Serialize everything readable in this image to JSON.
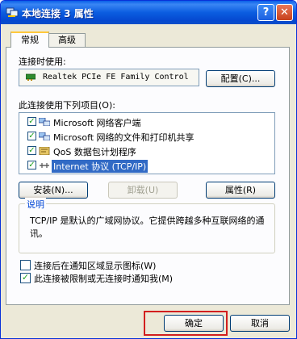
{
  "window": {
    "title": "本地连接 3 属性",
    "help_glyph": "?",
    "close_glyph": "✕"
  },
  "tabs": [
    {
      "label": "常规",
      "active": true
    },
    {
      "label": "高级",
      "active": false
    }
  ],
  "connect_using": {
    "label": "连接时使用:",
    "adapter": "Realtek PCIe FE Family Control",
    "configure_label": "配置(C)..."
  },
  "items_section": {
    "label": "此连接使用下列项目(O):",
    "items": [
      {
        "label": "Microsoft 网络客户端",
        "checked": true,
        "selected": false,
        "icon": "network-client-icon"
      },
      {
        "label": "Microsoft 网络的文件和打印机共享",
        "checked": true,
        "selected": false,
        "icon": "file-printer-sharing-icon"
      },
      {
        "label": "QoS 数据包计划程序",
        "checked": true,
        "selected": false,
        "icon": "qos-scheduler-icon"
      },
      {
        "label": "Internet 协议 (TCP/IP)",
        "checked": true,
        "selected": true,
        "icon": "protocol-icon"
      }
    ]
  },
  "item_buttons": {
    "install": "安装(N)...",
    "uninstall": "卸载(U)",
    "properties": "属性(R)"
  },
  "description": {
    "legend": "说明",
    "text": "TCP/IP 是默认的广域网协议。它提供跨越多种互联网络的通讯。"
  },
  "options": {
    "show_icon": {
      "label": "连接后在通知区域显示图标(W)",
      "checked": false
    },
    "notify_limited": {
      "label": "此连接被限制或无连接时通知我(M)",
      "checked": true
    }
  },
  "footer": {
    "ok": "确定",
    "cancel": "取消"
  },
  "colors": {
    "titlebar": "#0A5FE8",
    "dialog_bg": "#ECE9D8",
    "selection": "#316AC5",
    "highlight_box": "#D21F1F"
  }
}
